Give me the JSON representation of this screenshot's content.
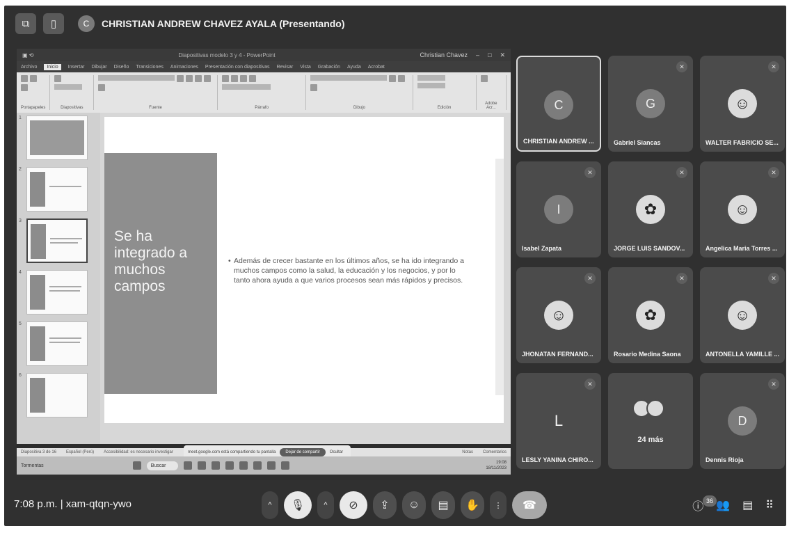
{
  "meeting": {
    "presenter_title": "CHRISTIAN ANDREW CHAVEZ AYALA (Presentando)",
    "presenter_initial": "C",
    "time": "7:08 p.m.",
    "separator": "|",
    "code": "xam-qtqn-ywo",
    "participant_count": "36"
  },
  "powerpoint": {
    "title": "Diapositivas modelo 3 y 4 - PowerPoint",
    "user": "Christian Chavez",
    "tabs": [
      "Archivo",
      "Inicio",
      "Insertar",
      "Dibujar",
      "Diseño",
      "Transiciones",
      "Animaciones",
      "Presentación con diapositivas",
      "Revisar",
      "Vista",
      "Grabación",
      "Ayuda",
      "Acrobat"
    ],
    "ribbon_groups": [
      "Portapapeles",
      "Diapositivas",
      "Fuente",
      "Párrafo",
      "Dibujo",
      "Edición",
      "Adobe Acr..."
    ],
    "slide_title": "Se ha integrado a muchos campos",
    "slide_bullet": "Además de crecer bastante en los últimos años, se ha ido integrando a muchos campos como la salud, la educación y los negocios, y por lo tanto ahora ayuda a que varios procesos sean más rápidos y precisos.",
    "share_notice": "meet.google.com está compartiendo tu pantalla",
    "stop_share": "Dejar de compartir",
    "hide": "Ocultar",
    "status_slide": "Diapositiva 3 de 16",
    "status_lang": "Español (Perú)",
    "status_access": "Accesibilidad: es necesario investigar",
    "status_notes": "Notas",
    "status_comments": "Comentarios",
    "taskbar_search": "Buscar",
    "taskbar_weather": "Tormentas",
    "taskbar_time": "19:08",
    "taskbar_date": "18/11/2023",
    "thumb_numbers": [
      "1",
      "2",
      "3",
      "4",
      "5",
      "6"
    ]
  },
  "participants": [
    {
      "name": "CHRISTIAN ANDREW ...",
      "initial": "C",
      "muted": false,
      "active": true,
      "photo": false
    },
    {
      "name": "Gabriel Siancas",
      "initial": "G",
      "muted": true,
      "active": false,
      "photo": false
    },
    {
      "name": "WALTER FABRICIO SE...",
      "initial": "☺",
      "muted": true,
      "active": false,
      "photo": true
    },
    {
      "name": "Isabel Zapata",
      "initial": "I",
      "muted": true,
      "active": false,
      "photo": false
    },
    {
      "name": "JORGE LUIS SANDOV...",
      "initial": "✿",
      "muted": true,
      "active": false,
      "photo": true
    },
    {
      "name": "Angelica Maria Torres ...",
      "initial": "☺",
      "muted": true,
      "active": false,
      "photo": true
    },
    {
      "name": "JHONATAN FERNAND...",
      "initial": "☺",
      "muted": true,
      "active": false,
      "photo": true
    },
    {
      "name": "Rosario Medina Saona",
      "initial": "✿",
      "muted": true,
      "active": false,
      "photo": true
    },
    {
      "name": "ANTONELLA YAMILLE ...",
      "initial": "☺",
      "muted": true,
      "active": false,
      "photo": true
    },
    {
      "name": "LESLY YANINA CHIRO...",
      "initial": "L",
      "muted": true,
      "active": false,
      "photo": false
    },
    {
      "name": "",
      "initial": "",
      "muted": false,
      "active": false,
      "photo": false,
      "more": "24 más"
    },
    {
      "name": "Dennis Rioja",
      "initial": "D",
      "muted": true,
      "active": false,
      "photo": false
    }
  ],
  "icons": {
    "mute": "mic-off-icon",
    "camera_off": "camera-off-icon",
    "present": "present-screen-icon",
    "reactions": "emoji-icon",
    "captions": "captions-icon",
    "hand": "raise-hand-icon",
    "more": "more-vert-icon",
    "end_call": "end-call-icon",
    "info": "info-icon",
    "people": "people-icon",
    "chat": "chat-icon",
    "activities": "activities-icon"
  },
  "colors": {
    "background": "#303030",
    "tile": "#4b4b4b",
    "slide_accent": "#8e8e8e"
  }
}
